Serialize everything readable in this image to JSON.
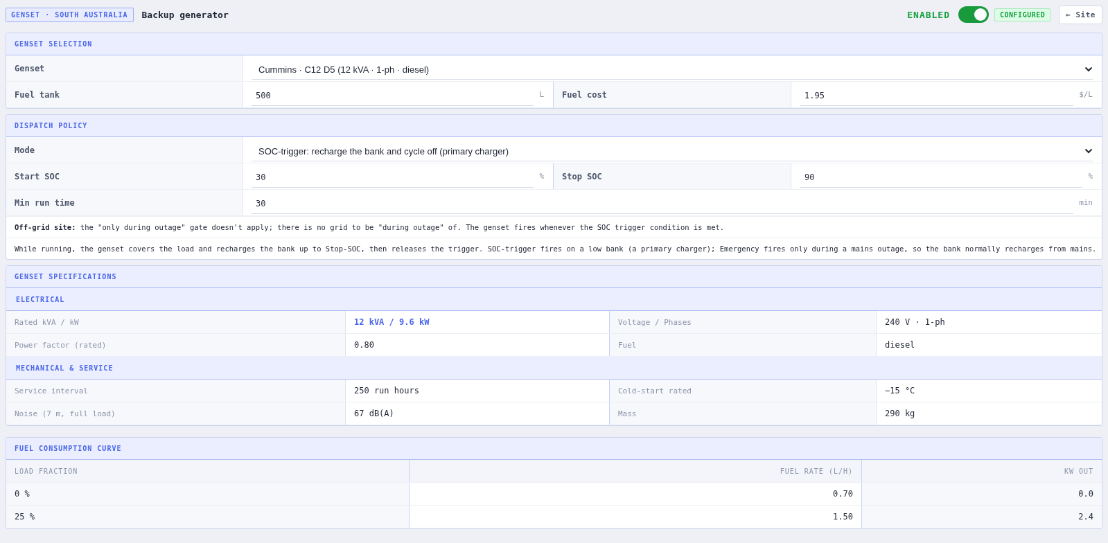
{
  "header": {
    "tag": "GENSET · SOUTH AUSTRALIA",
    "title": "Backup generator",
    "status_label": "ENABLED",
    "enabled": true,
    "badge": "CONFIGURED",
    "back_button": "← Site"
  },
  "genset_selection": {
    "title": "GENSET SELECTION",
    "genset": {
      "label": "Genset",
      "value": "Cummins · C12 D5 (12 kVA · 1-ph · diesel)"
    },
    "fields": [
      {
        "label": "Fuel tank",
        "value": "500",
        "unit": "L"
      },
      {
        "label": "Fuel cost",
        "value": "1.95",
        "unit": "$/L"
      }
    ]
  },
  "dispatch_policy": {
    "title": "DISPATCH POLICY",
    "mode": {
      "label": "Mode",
      "value": "SOC-trigger: recharge the bank and cycle off (primary charger)"
    },
    "soc_fields": [
      {
        "label": "Start SOC",
        "value": "30",
        "unit": "%"
      },
      {
        "label": "Stop SOC",
        "value": "90",
        "unit": "%"
      }
    ],
    "min_run": {
      "label": "Min run time",
      "value": "30",
      "unit": "min"
    },
    "notes": [
      "**Off-grid site:** the \"only during outage\" gate doesn't apply; there is no grid to be \"during outage\" of. The genset fires whenever the SOC trigger condition is met.",
      "While running, the genset covers the load and recharges the bank up to Stop-SOC, then releases the trigger. SOC-trigger fires on a low bank (a primary charger); Emergency fires only during a mains outage, so the bank normally recharges from mains."
    ]
  },
  "specifications": {
    "title": "GENSET SPECIFICATIONS",
    "groups": [
      {
        "title": "ELECTRICAL",
        "rows": [
          [
            {
              "label": "Rated kVA / kW",
              "value": "12 kVA / 9.6 kW",
              "emphasis": true
            },
            {
              "label": "Voltage / Phases",
              "value": "240 V · 1-ph",
              "emphasis": false
            }
          ],
          [
            {
              "label": "Power factor (rated)",
              "value": "0.80",
              "emphasis": false
            },
            {
              "label": "Fuel",
              "value": "diesel",
              "emphasis": false
            }
          ]
        ]
      },
      {
        "title": "MECHANICAL & SERVICE",
        "rows": [
          [
            {
              "label": "Service interval",
              "value": "250 run hours",
              "emphasis": false
            },
            {
              "label": "Cold-start rated",
              "value": "−15 °C",
              "emphasis": false
            }
          ],
          [
            {
              "label": "Noise (7 m, full load)",
              "value": "67 dB(A)",
              "emphasis": false
            },
            {
              "label": "Mass",
              "value": "290 kg",
              "emphasis": false
            }
          ]
        ]
      }
    ]
  },
  "fuel_curve": {
    "title": "FUEL CONSUMPTION CURVE",
    "columns": [
      "LOAD FRACTION",
      "FUEL RATE (L/H)",
      "KW OUT"
    ],
    "rows": [
      [
        "0 %",
        "0.70",
        "0.0"
      ],
      [
        "25 %",
        "1.50",
        "2.4"
      ]
    ]
  }
}
